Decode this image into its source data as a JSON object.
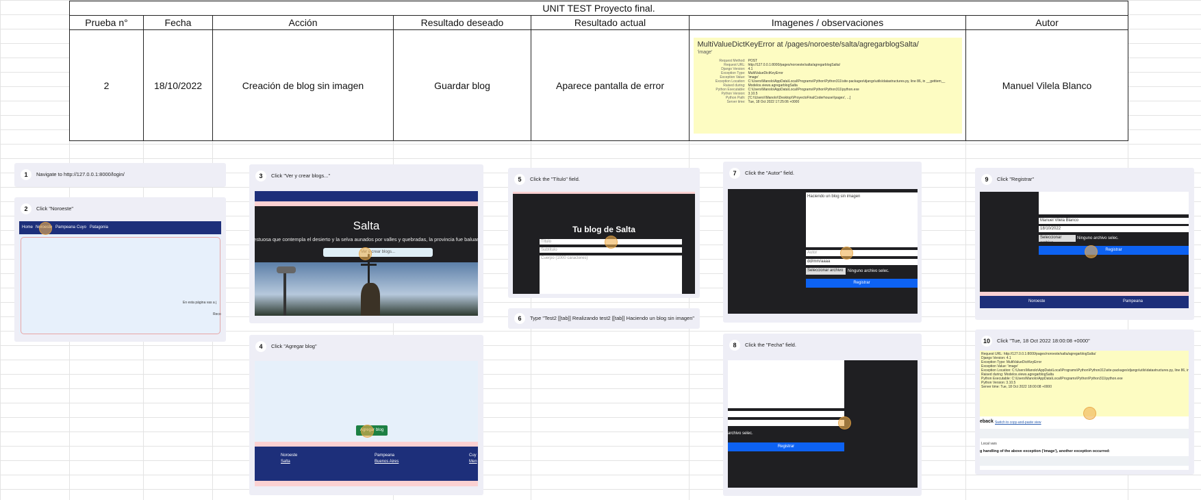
{
  "sheet": {
    "title": "UNIT TEST Proyecto final.",
    "headers": [
      "Prueba n°",
      "Fecha",
      "Acción",
      "Resultado deseado",
      "Resultado actual",
      "Imagenes / observaciones",
      "Autor"
    ],
    "row": {
      "prueba": "2",
      "fecha": "18/10/2022",
      "accion": "Creación de blog sin imagen",
      "deseado": "Guardar blog",
      "actual": "Aparece pantalla de error",
      "autor": "Manuel Vilela Blanco"
    },
    "error": {
      "heading": "MultiValueDictKeyError at /pages/noroeste/salta/agregarblogSalta/",
      "sub": "'image'",
      "rows": [
        [
          "Request Method:",
          "POST"
        ],
        [
          "Request URL:",
          "http://127.0.0.1:8000/pages/noroeste/salta/agregarblogSalta/"
        ],
        [
          "Django Version:",
          "4.1"
        ],
        [
          "Exception Type:",
          "MultiValueDictKeyError"
        ],
        [
          "Exception Value:",
          "'image'"
        ],
        [
          "Exception Location:",
          "C:\\Users\\Manolo\\AppData\\Local\\Programs\\Python\\Python311\\site-packages\\django\\utils\\datastructures.py, line 86, in __getitem__"
        ],
        [
          "Raised during:",
          "Modelos.views.agregarblogSalta"
        ],
        [
          "Python Executable:",
          "C:\\Users\\Manolo\\AppData\\Local\\Programs\\Python\\Python311\\python.exe"
        ],
        [
          "Python Version:",
          "3.10.5"
        ],
        [
          "Python Path:",
          "['C:\\\\Users\\\\Manolo\\\\Desktop\\\\ProyectoFinalCoderhouse\\\\pages', ...]"
        ],
        [
          "Server time:",
          "Tue, 18 Oct 2022 17:25:06 +0000"
        ]
      ]
    }
  },
  "steps": [
    {
      "n": "1",
      "caption": "Navigate to http://127.0.0.1:8000/login/"
    },
    {
      "n": "2",
      "caption": "Click \"Noroeste\""
    },
    {
      "n": "3",
      "caption": "Click \"Ver y crear blogs...\""
    },
    {
      "n": "4",
      "caption": "Click \"Agregar blog\""
    },
    {
      "n": "5",
      "caption": "Click the \"Título\" field."
    },
    {
      "n": "6",
      "caption": "Type \"Test2 [[tab]] Realizando test2 [[tab]] Haciendo un blog sin imagen\""
    },
    {
      "n": "7",
      "caption": "Click the \"Autor\" field."
    },
    {
      "n": "8",
      "caption": "Click the \"Fecha\" field."
    },
    {
      "n": "9",
      "caption": "Click \"Registrar\""
    },
    {
      "n": "10",
      "caption": "Click \"Tue, 18 Oct 2022 18:00:08 +0000\""
    }
  ],
  "shots": {
    "s2": {
      "nav": [
        "Home",
        "Noroeste",
        "Pampeana",
        "Cuyo",
        "Patagonia"
      ],
      "body": "En esta página vas a j",
      "body2": "Reco"
    },
    "s3": {
      "title": "Salta",
      "tagline": "estuosa que contempla el desierto y la selva aunados por valles y quebradas, la provincia fue baluart",
      "button": "Ver y crear blogs..."
    },
    "s4": {
      "button": "Agregar blog",
      "footer": [
        "Noroeste",
        "Pampeana",
        "Cuy"
      ],
      "footer2": [
        "Salta",
        "Buenos Aires",
        "Men"
      ]
    },
    "s5": {
      "title": "Tu blog de Salta",
      "f1": "Título",
      "f2": "Subtítulo",
      "f3": "Cuerpo (1000 caracteres)"
    },
    "s7": {
      "body": "Haciendo un blog sin imagen",
      "autor": "Autor",
      "fecha": "dd/mm/aaaa",
      "file": "Seleccionar archivo",
      "nofile": "Ninguno archivo selec.",
      "btn": "Registrar"
    },
    "s8": {
      "nofile": "archivo selec.",
      "btn": "Registrar"
    },
    "s9": {
      "autor": "Manuel Vilela Blanco",
      "fecha": "18/10/2022",
      "file": "Seleccionar archivo",
      "nofile": "Ninguno archivo selec.",
      "btn": "Registrar",
      "footer": [
        "Noroeste",
        "Pampeana"
      ]
    },
    "s10": {
      "lines": [
        "Request URL:  http://127.0.0.1:8000/pages/noroeste/salta/agregarblogSalta/",
        "Django Version:  4.1",
        "Exception Type:  MultiValueDictKeyError",
        "Exception Value:  'image'",
        "Exception Location:  C:\\Users\\Manolo\\AppData\\Local\\Programs\\Python\\Python311\\site-packages\\django\\utils\\datastructures.py, line 86, in __getitem__",
        "Raised during:  Modelos.views.agregarblogSalta",
        "Python Executable:  C:\\Users\\Manolo\\AppData\\Local\\Programs\\Python\\Python311\\python.exe",
        "Python Version:  3.10.5",
        "Server time:  Tue, 18 Oct 2022 18:00:08 +0000"
      ],
      "traceback": "eback",
      "switch": "Switch to copy-and-paste view",
      "local": "Local vars",
      "handling": "g handling of the above exception ('image'), another exception occurred:"
    }
  }
}
